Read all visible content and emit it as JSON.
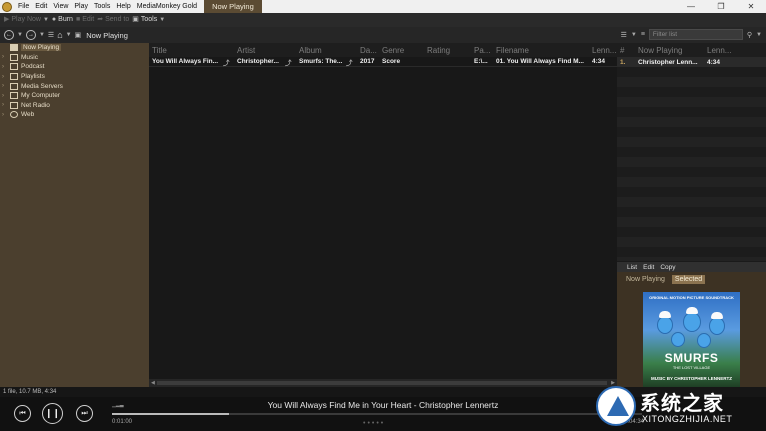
{
  "menubar": {
    "items": [
      "File",
      "Edit",
      "View",
      "Play",
      "Tools",
      "Help",
      "MediaMonkey Gold"
    ],
    "active_tab": "Now Playing"
  },
  "toolbar": {
    "play_now": "Play Now",
    "burn": "Burn",
    "edit": "Edit",
    "send_to": "Send to",
    "tools": "Tools"
  },
  "nav": {
    "location": "Now Playing",
    "filter_placeholder": "Filter list"
  },
  "tree": {
    "items": [
      {
        "label": "Now Playing",
        "icon": "now-playing-icon",
        "selected": true
      },
      {
        "label": "Music",
        "icon": "music-icon"
      },
      {
        "label": "Podcast",
        "icon": "podcast-icon"
      },
      {
        "label": "Playlists",
        "icon": "playlists-icon"
      },
      {
        "label": "Media Servers",
        "icon": "media-servers-icon"
      },
      {
        "label": "My Computer",
        "icon": "computer-icon"
      },
      {
        "label": "Net Radio",
        "icon": "net-radio-icon"
      },
      {
        "label": "Web",
        "icon": "web-icon"
      }
    ]
  },
  "tracklist": {
    "columns": [
      "Title",
      "Artist",
      "Album",
      "Da...",
      "Genre",
      "Rating",
      "Pa...",
      "Filename",
      "Lenn..."
    ],
    "rows": [
      {
        "title": "You Will Always Fin...",
        "artist": "Christopher...",
        "album": "Smurfs: The...",
        "date": "2017",
        "genre": "Score",
        "rating": "",
        "path": "E:\\...",
        "filename": "01. You Will Always Find M...",
        "length": "4:34"
      }
    ]
  },
  "now_playing_panel": {
    "columns": [
      "#",
      "Now Playing",
      "Lenn..."
    ],
    "rows": [
      {
        "num": "1.",
        "artist": "Christopher Lenn...",
        "length": "4:34"
      }
    ],
    "menu": [
      "List",
      "Edit",
      "Copy"
    ],
    "tabs": [
      "Now Playing",
      "Selected"
    ],
    "active_tab": "Selected"
  },
  "album_art": {
    "top_text": "ORIGINAL MOTION PICTURE SOUNDTRACK",
    "title": "SMURFS",
    "subtitle": "THE LOST VILLAGE",
    "credit": "MUSIC BY CHRISTOPHER LENNERTZ"
  },
  "status": {
    "text": "1 file, 10.7 MB, 4:34"
  },
  "player": {
    "track": "You Will Always Find Me in Your Heart - Christopher Lennertz",
    "elapsed": "0:01:00",
    "remaining": "-0:04:34",
    "progress": 0.22,
    "prev_icon": "previous-icon",
    "pause_icon": "pause-icon",
    "next_icon": "next-icon"
  },
  "watermark": {
    "cn": "系统之家",
    "en": "XITONGZHIJIA.NET"
  },
  "colors": {
    "tree_bg": "#4b3f2e",
    "active_tab": "#5b4b33",
    "selected_tab": "#8b7350"
  }
}
